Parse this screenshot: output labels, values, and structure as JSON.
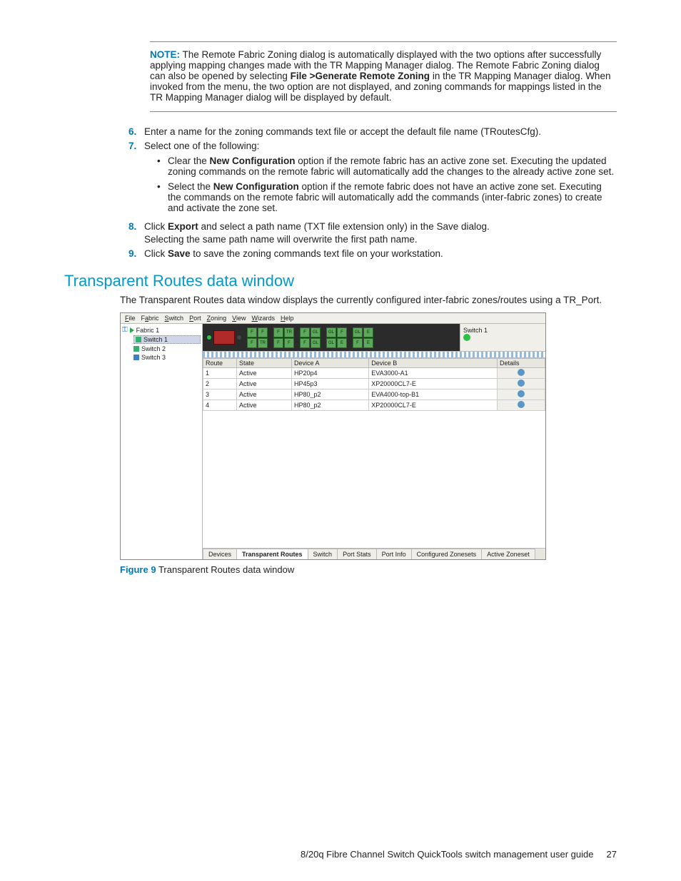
{
  "note": {
    "label": "NOTE:",
    "text_before_bold": "The Remote Fabric Zoning dialog is automatically displayed with the two options after successfully applying mapping changes made with the TR Mapping Manager dialog. The Remote Fabric Zoning dialog can also be opened by selecting ",
    "bold": "File >Generate Remote Zoning",
    "text_after_bold": " in the TR Mapping Manager dialog. When invoked from the menu, the two option are not displayed, and zoning commands for mappings listed in the TR Mapping Manager dialog will be displayed by default."
  },
  "steps": {
    "s6_num": "6.",
    "s6": "Enter a name for the zoning commands text file or accept the default file name (TRoutesCfg).",
    "s7_num": "7.",
    "s7": "Select one of the following:",
    "s7_bullets": [
      {
        "pre": "Clear the ",
        "bold": "New Configuration",
        "post": " option if the remote fabric has an active zone set. Executing the updated zoning commands on the remote fabric will automatically add the changes to the already active zone set."
      },
      {
        "pre": "Select the ",
        "bold": "New Configuration",
        "post": " option if the remote fabric does not have an active zone set. Executing the commands on the remote fabric will automatically add the commands (inter-fabric zones) to create and activate the zone set."
      }
    ],
    "s8_num": "8.",
    "s8_pre": "Click ",
    "s8_bold": "Export",
    "s8_post": " and select a path name (TXT file extension only) in the Save dialog.",
    "s8_line2": "Selecting the same path name will overwrite the first path name.",
    "s9_num": "9.",
    "s9_pre": "Click ",
    "s9_bold": "Save",
    "s9_post": " to save the zoning commands text file on your workstation."
  },
  "heading": "Transparent Routes data window",
  "heading_text": "The Transparent Routes data window displays the currently configured inter-fabric zones/routes using a TR_Port.",
  "app": {
    "menus": [
      "File",
      "Fabric",
      "Switch",
      "Port",
      "Zoning",
      "View",
      "Wizards",
      "Help"
    ],
    "tree": {
      "root": "Fabric 1",
      "items": [
        "Switch 1",
        "Switch 2",
        "Switch 3"
      ]
    },
    "status_label": "Switch 1",
    "port_labels": [
      [
        "F",
        "F",
        "F",
        "TR",
        "F",
        "GL",
        "GL",
        "F",
        "F",
        "GL",
        "E"
      ],
      [
        "F",
        "TR",
        "F",
        "GL",
        "GL",
        "E",
        "F",
        "E"
      ]
    ],
    "table": {
      "headers": [
        "Route",
        "State",
        "Device A",
        "Device B",
        "Details"
      ],
      "rows": [
        {
          "route": "1",
          "state": "Active",
          "a": "HP20p4",
          "b": "EVA3000-A1"
        },
        {
          "route": "2",
          "state": "Active",
          "a": "HP45p3",
          "b": "XP20000CL7-E"
        },
        {
          "route": "3",
          "state": "Active",
          "a": "HP80_p2",
          "b": "EVA4000-top-B1"
        },
        {
          "route": "4",
          "state": "Active",
          "a": "HP80_p2",
          "b": "XP20000CL7-E"
        }
      ]
    },
    "tabs": [
      "Devices",
      "Transparent Routes",
      "Switch",
      "Port Stats",
      "Port Info",
      "Configured Zonesets",
      "Active Zoneset"
    ]
  },
  "figure": {
    "label": "Figure 9",
    "text": "Transparent Routes data window"
  },
  "footer": {
    "text": "8/20q Fibre Channel Switch QuickTools switch management user guide",
    "page": "27"
  }
}
